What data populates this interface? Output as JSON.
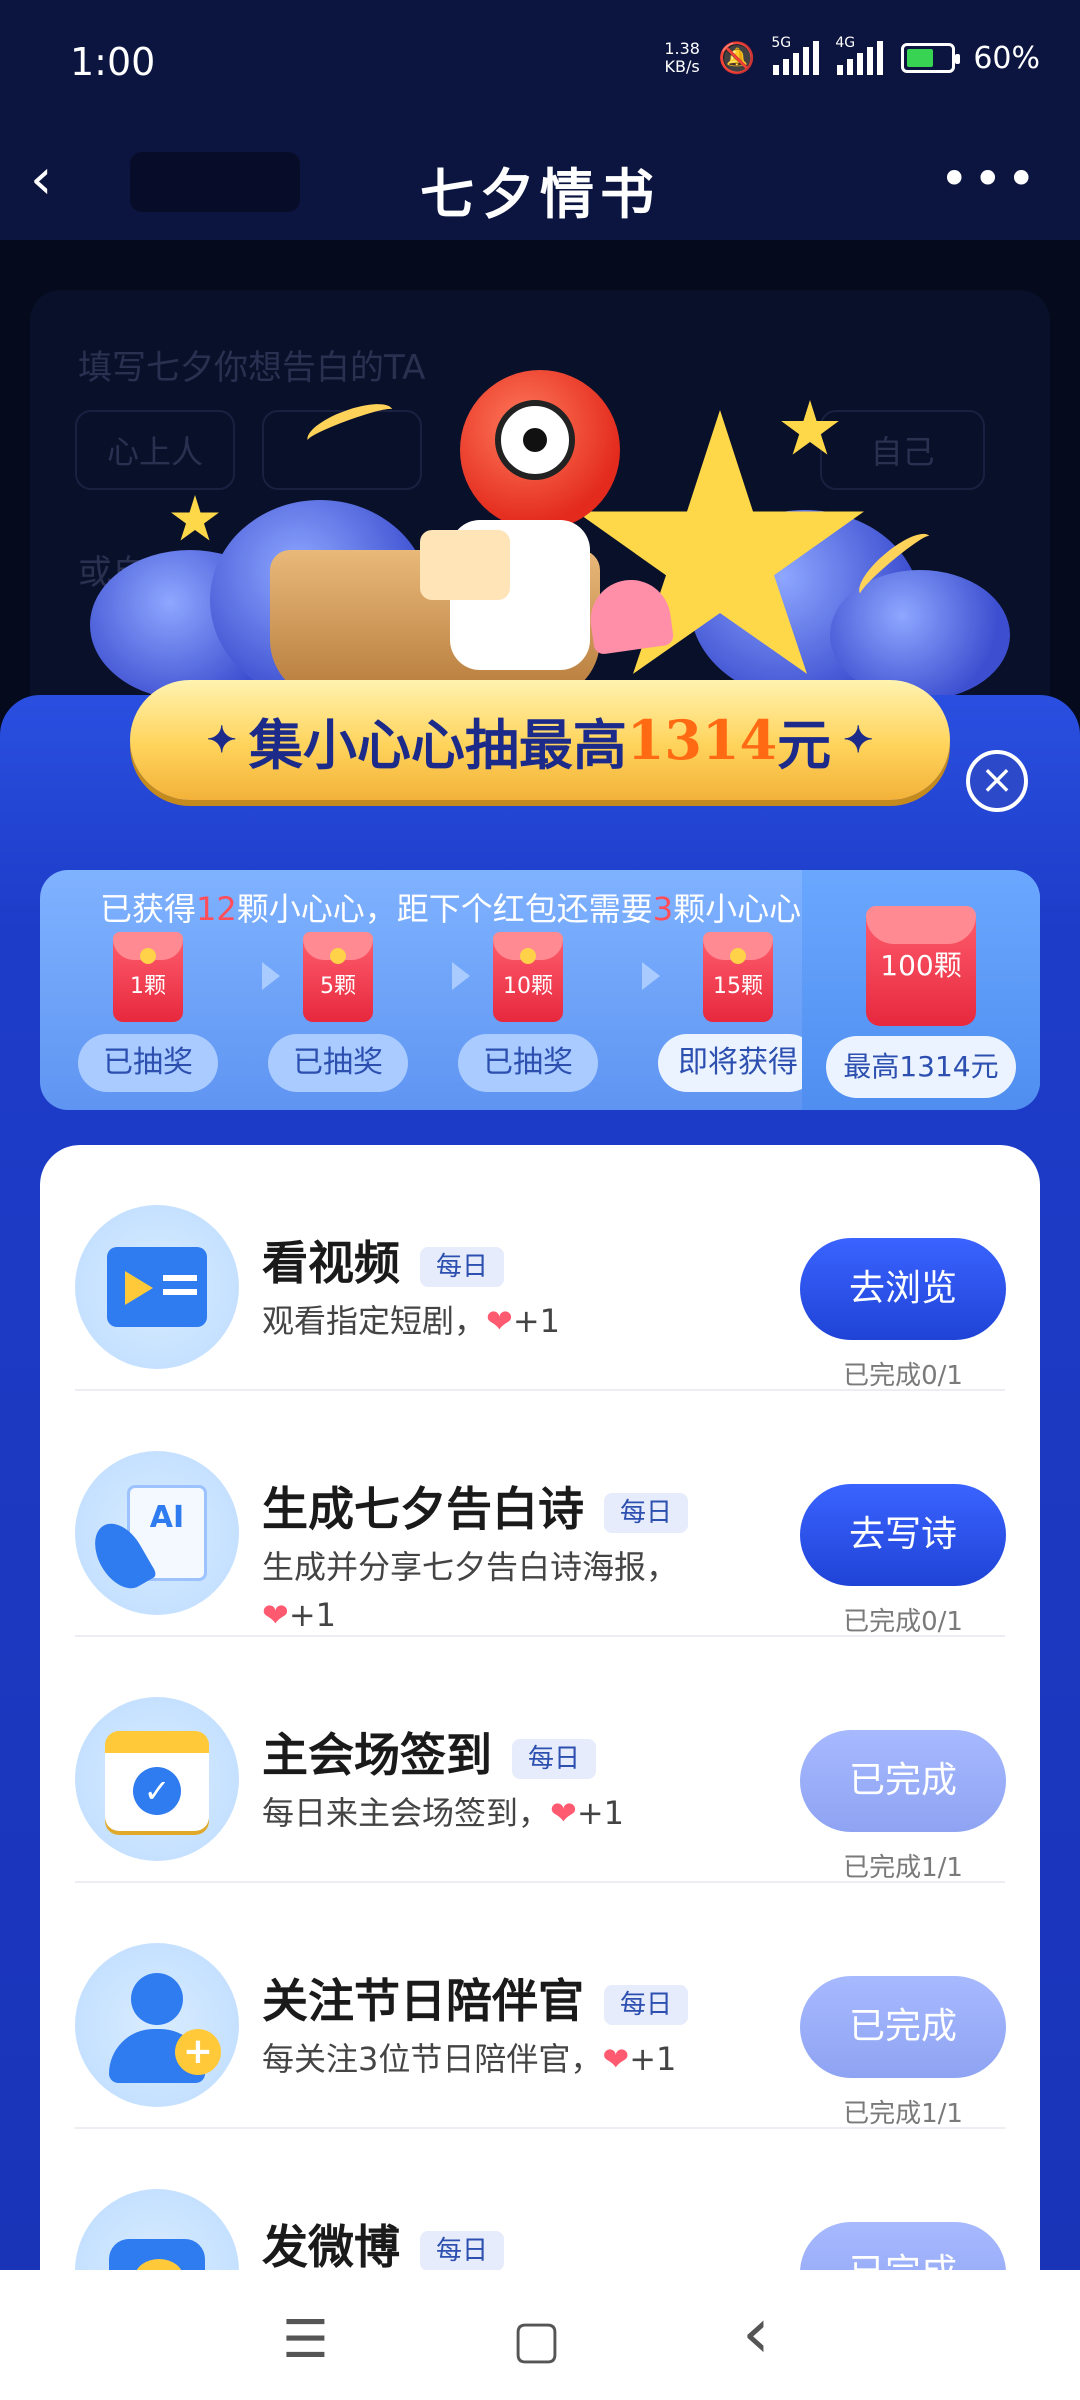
{
  "status": {
    "time": "1:00",
    "net_speed_top": "1.38",
    "net_speed_bottom": "KB/s",
    "sig1_label": "5G",
    "sig2_label": "4G",
    "battery_pct": "60%",
    "battery_level": 0.6
  },
  "nav": {
    "back_icon": "chevron-left-icon",
    "title": "七夕情书",
    "more_label": "•••"
  },
  "background_form": {
    "prompt": "填写七夕你想告白的TA",
    "chips": [
      "心上人",
      "",
      "",
      "",
      "自己"
    ],
    "custom_label": "或自定义"
  },
  "modal": {
    "banner_prefix": "集小心心抽最高",
    "banner_amount": "1314",
    "banner_suffix": "元",
    "close_label": "×",
    "progress": {
      "msg_a": "已获得",
      "collected": "12",
      "msg_b": "颗小心心，距下个红包还需要",
      "remaining": "3",
      "msg_c": "颗小心心",
      "stages": [
        {
          "count": "1颗",
          "status": "已抽奖"
        },
        {
          "count": "5颗",
          "status": "已抽奖"
        },
        {
          "count": "10颗",
          "status": "已抽奖"
        },
        {
          "count": "15颗",
          "status": "即将获得"
        }
      ],
      "final": {
        "count": "100颗",
        "status": "最高1314元"
      }
    },
    "tasks": [
      {
        "name": "看视频",
        "badge": "每日",
        "desc": "观看指定短剧，",
        "reward": "+1",
        "button": "去浏览",
        "progress": "已完成0/1",
        "done": false,
        "icon": "video-player-icon"
      },
      {
        "name": "生成七夕告白诗",
        "badge": "每日",
        "desc": "生成并分享七夕告白诗海报，",
        "reward": "+1",
        "button": "去写诗",
        "progress": "已完成0/1",
        "done": false,
        "icon": "ai-scroll-quill-icon"
      },
      {
        "name": "主会场签到",
        "badge": "每日",
        "desc": "每日来主会场签到，",
        "reward": "+1",
        "button": "已完成",
        "progress": "已完成1/1",
        "done": true,
        "icon": "calendar-check-icon"
      },
      {
        "name": "关注节日陪伴官",
        "badge": "每日",
        "desc": "每关注3位节日陪伴官，",
        "reward": "+1",
        "button": "已完成",
        "progress": "已完成1/1",
        "done": true,
        "icon": "user-add-icon"
      },
      {
        "name": "发微博",
        "badge": "每日",
        "desc": "",
        "reward": "",
        "button": "已完成",
        "progress": "",
        "done": true,
        "icon": "weibo-icon"
      }
    ]
  },
  "bottom_nav": {
    "menu": "☰",
    "home": "▢",
    "back": "‹"
  }
}
